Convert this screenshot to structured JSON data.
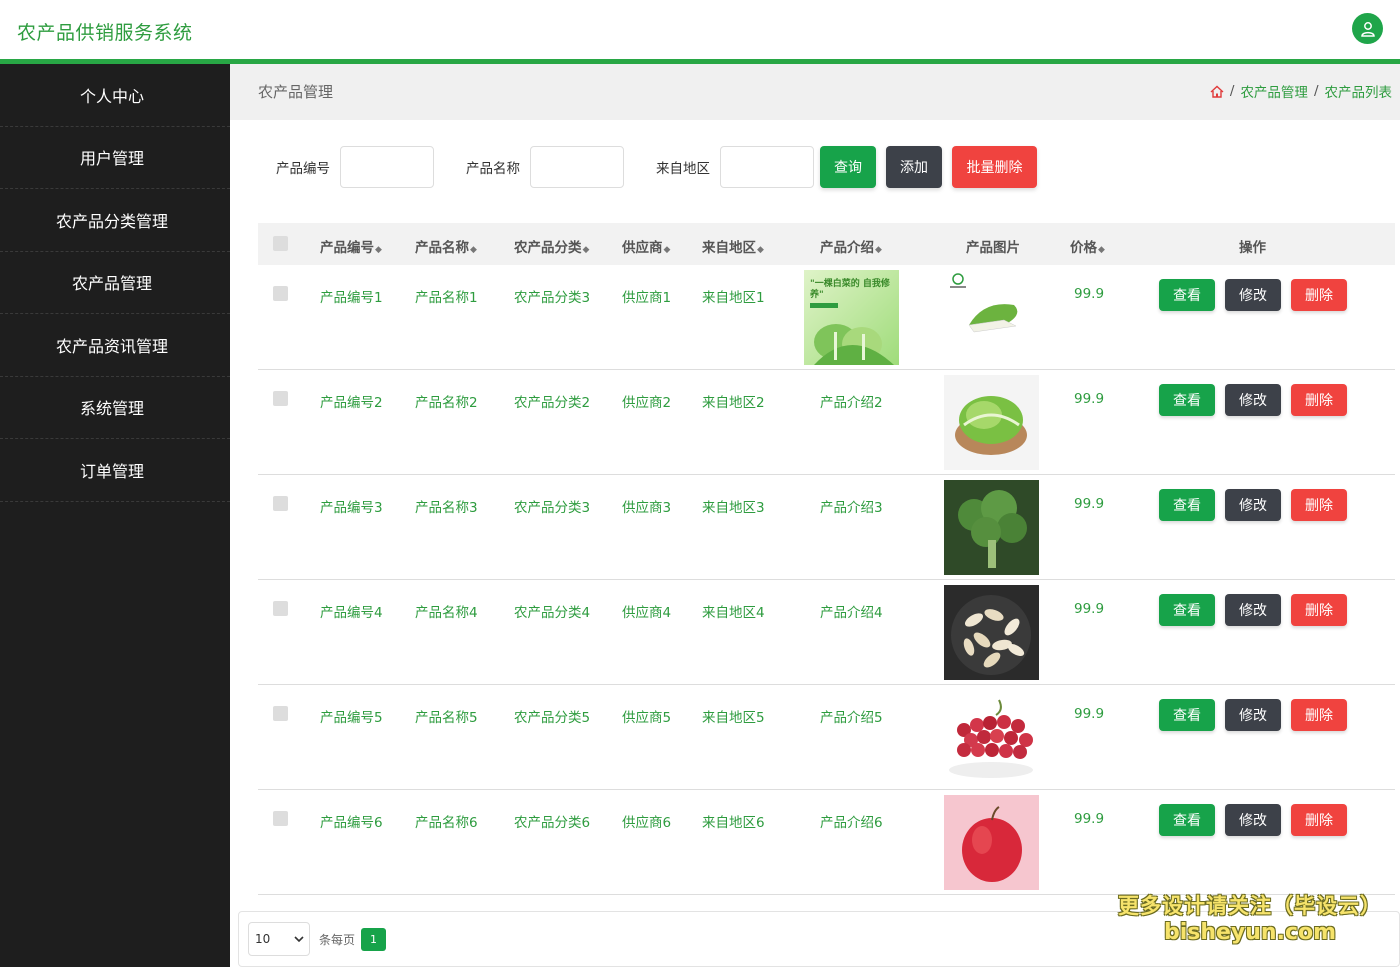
{
  "header": {
    "app_title": "农产品供销服务系统",
    "avatar_icon": "user-icon"
  },
  "sidebar": {
    "items": [
      {
        "label": "个人中心"
      },
      {
        "label": "用户管理"
      },
      {
        "label": "农产品分类管理"
      },
      {
        "label": "农产品管理"
      },
      {
        "label": "农产品资讯管理"
      },
      {
        "label": "系统管理"
      },
      {
        "label": "订单管理"
      }
    ]
  },
  "crumbbar": {
    "title": "农产品管理",
    "home_icon": "home-icon",
    "crumbs": [
      "农产品管理",
      "农产品列表"
    ],
    "separator": "/"
  },
  "search": {
    "code_label": "产品编号",
    "name_label": "产品名称",
    "region_label": "来自地区",
    "query_label": "查询",
    "add_label": "添加",
    "batch_delete_label": "批量删除"
  },
  "table": {
    "headers": {
      "code": "产品编号",
      "name": "产品名称",
      "category": "农产品分类",
      "supplier": "供应商",
      "region": "来自地区",
      "intro": "产品介绍",
      "image": "产品图片",
      "price": "价格",
      "actions": "操作"
    },
    "action_labels": {
      "view": "查看",
      "edit": "修改",
      "delete": "删除"
    },
    "rows": [
      {
        "code": "产品编号1",
        "name": "产品名称1",
        "category": "农产品分类3",
        "supplier": "供应商1",
        "region": "来自地区1",
        "intro": "",
        "image_text": "\"一棵白菜的 自我修养\"",
        "price": "99.9"
      },
      {
        "code": "产品编号2",
        "name": "产品名称2",
        "category": "农产品分类2",
        "supplier": "供应商2",
        "region": "来自地区2",
        "intro": "产品介绍2",
        "image_text": "",
        "price": "99.9"
      },
      {
        "code": "产品编号3",
        "name": "产品名称3",
        "category": "农产品分类3",
        "supplier": "供应商3",
        "region": "来自地区3",
        "intro": "产品介绍3",
        "image_text": "",
        "price": "99.9"
      },
      {
        "code": "产品编号4",
        "name": "产品名称4",
        "category": "农产品分类4",
        "supplier": "供应商4",
        "region": "来自地区4",
        "intro": "产品介绍4",
        "image_text": "",
        "price": "99.9"
      },
      {
        "code": "产品编号5",
        "name": "产品名称5",
        "category": "农产品分类5",
        "supplier": "供应商5",
        "region": "来自地区5",
        "intro": "产品介绍5",
        "image_text": "",
        "price": "99.9"
      },
      {
        "code": "产品编号6",
        "name": "产品名称6",
        "category": "农产品分类6",
        "supplier": "供应商6",
        "region": "来自地区6",
        "intro": "产品介绍6",
        "image_text": "",
        "price": "99.9"
      }
    ]
  },
  "pagination": {
    "page_size": "10",
    "per_page_label": "条每页",
    "current_page": "1"
  },
  "watermark": {
    "line1": "更多设计请关注（毕设云）",
    "line2": "bisheyun.com"
  },
  "colors": {
    "accent_green": "#17a34a",
    "text_green": "#2e9c3f",
    "dark_button": "#3d4149",
    "danger": "#f0433f",
    "sidebar_bg": "#1e1e1e"
  }
}
